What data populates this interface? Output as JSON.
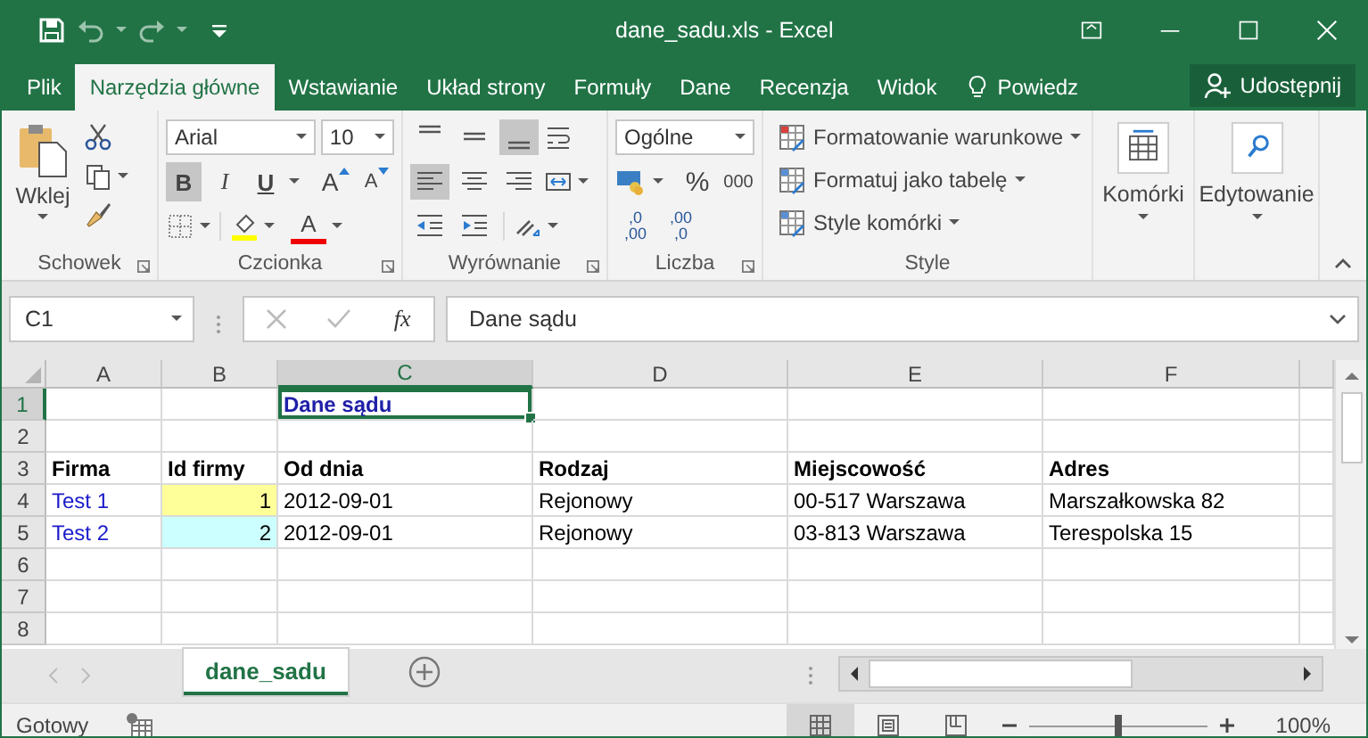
{
  "window": {
    "title": "dane_sadu.xls - Excel"
  },
  "menu_tabs": [
    {
      "label": "Plik",
      "selected": false
    },
    {
      "label": "Narzędzia główne",
      "selected": true
    },
    {
      "label": "Wstawianie",
      "selected": false
    },
    {
      "label": "Układ strony",
      "selected": false
    },
    {
      "label": "Formuły",
      "selected": false
    },
    {
      "label": "Dane",
      "selected": false
    },
    {
      "label": "Recenzja",
      "selected": false
    },
    {
      "label": "Widok",
      "selected": false
    }
  ],
  "tell_me": "Powiedz",
  "share_button": "Udostępnij",
  "clipboard": {
    "paste": "Wklej",
    "group": "Schowek"
  },
  "font": {
    "name": "Arial",
    "size": "10",
    "group": "Czcionka",
    "styles": [
      {
        "label": "B",
        "selected": true
      },
      {
        "label": "I",
        "selected": false
      },
      {
        "label": "U",
        "selected": false
      }
    ],
    "grow": "A",
    "shrink": "A",
    "color_button": "A"
  },
  "alignment": {
    "group": "Wyrównanie",
    "vertical": [
      {
        "selected": false
      },
      {
        "selected": false
      },
      {
        "selected": true
      }
    ],
    "horizontal": [
      {
        "selected": true
      },
      {
        "selected": false
      },
      {
        "selected": false
      }
    ]
  },
  "number": {
    "format": "Ogólne",
    "percent": "%",
    "thousands": "000",
    "group": "Liczba",
    "decimal_buttons": [
      {
        "top": ",0",
        "bottom": ",00"
      },
      {
        "top": ",00",
        "bottom": ",0"
      }
    ]
  },
  "styles": {
    "items": [
      "Formatowanie warunkowe",
      "Formatuj jako tabelę",
      "Style komórki"
    ],
    "group": "Style"
  },
  "cells_button": "Komórki",
  "editing_button": "Edytowanie",
  "formula_bar": {
    "name_box": "C1",
    "function_label": "fx",
    "value": "Dane sądu"
  },
  "grid": {
    "columns": [
      {
        "label": "A",
        "selected": false
      },
      {
        "label": "B",
        "selected": false
      },
      {
        "label": "C",
        "selected": true
      },
      {
        "label": "D",
        "selected": false
      },
      {
        "label": "E",
        "selected": false
      },
      {
        "label": "F",
        "selected": false
      }
    ],
    "rows": [
      {
        "number": "1",
        "selected": true,
        "cells": [
          null,
          null,
          {
            "text": "Dane sądu",
            "kind": "title",
            "selected": true
          },
          null,
          null,
          null
        ]
      },
      {
        "number": "2",
        "selected": false
      },
      {
        "number": "3",
        "selected": false,
        "cells": [
          {
            "text": "Firma",
            "kind": "header",
            "selected": false
          },
          {
            "text": "Id firmy",
            "kind": "header",
            "selected": false
          },
          {
            "text": "Od dnia",
            "kind": "header",
            "selected": false
          },
          {
            "text": "Rodzaj",
            "kind": "header",
            "selected": false
          },
          {
            "text": "Miejscowość",
            "kind": "header",
            "selected": false
          },
          {
            "text": "Adres",
            "kind": "header",
            "selected": false
          }
        ]
      },
      {
        "number": "4",
        "selected": false,
        "cells": [
          {
            "text": "Test 1",
            "kind": "link",
            "selected": false
          },
          {
            "text": "1",
            "kind": "number",
            "color": "#ffff99",
            "selected": false
          },
          {
            "text": "2012-09-01",
            "kind": "text",
            "selected": false
          },
          {
            "text": "Rejonowy",
            "kind": "text",
            "selected": false
          },
          {
            "text": "00-517 Warszawa",
            "kind": "text",
            "selected": false
          },
          {
            "text": "Marszałkowska 82",
            "kind": "text",
            "selected": false
          }
        ]
      },
      {
        "number": "5",
        "selected": false,
        "cells": [
          {
            "text": "Test 2",
            "kind": "link",
            "selected": false
          },
          {
            "text": "2",
            "kind": "number",
            "color": "#ccffff",
            "selected": false
          },
          {
            "text": "2012-09-01",
            "kind": "text",
            "selected": false
          },
          {
            "text": "Rejonowy",
            "kind": "text",
            "selected": false
          },
          {
            "text": "03-813 Warszawa",
            "kind": "text",
            "selected": false
          },
          {
            "text": "Terespolska 15",
            "kind": "text",
            "selected": false
          }
        ]
      },
      {
        "number": "6",
        "selected": false
      },
      {
        "number": "7",
        "selected": false
      },
      {
        "number": "8",
        "selected": false
      }
    ]
  },
  "sheet_tabs": [
    {
      "label": "dane_sadu",
      "selected": true
    }
  ],
  "status_bar": {
    "status": "Gotowy",
    "views": [
      {
        "kind": "normal",
        "selected": true
      },
      {
        "kind": "page_layout",
        "selected": false
      },
      {
        "kind": "page_break",
        "selected": false
      }
    ],
    "zoom_slider": {
      "level": 0.5
    },
    "zoom": "100%"
  }
}
